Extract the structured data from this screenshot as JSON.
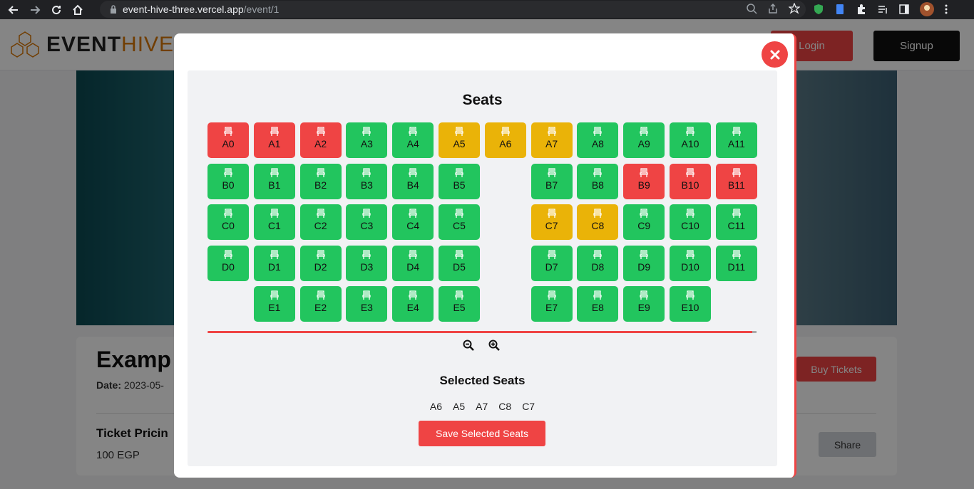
{
  "browser": {
    "url_host": "event-hive-three.vercel.app",
    "url_path": "/event/1"
  },
  "header": {
    "logo_part1": "EVENT",
    "logo_part2": "HIVE",
    "login_label": "Login",
    "signup_label": "Signup"
  },
  "event": {
    "title": "Examp",
    "date_label": "Date:",
    "date_value": "2023-05-",
    "pricing_title": "Ticket Pricin",
    "price": "100 EGP",
    "buy_label": "Buy Tickets",
    "share_label": "Share"
  },
  "modal": {
    "seats_title": "Seats",
    "selected_title": "Selected Seats",
    "selected_seats": [
      "A6",
      "A5",
      "A7",
      "C8",
      "C7"
    ],
    "save_label": "Save Selected Seats"
  },
  "status_colors": {
    "available": "#22c55e",
    "booked": "#ef4444",
    "selected": "#eab308"
  },
  "seat_rows": [
    {
      "row": "A",
      "seats": [
        {
          "label": "A0",
          "status": "booked",
          "col": 0
        },
        {
          "label": "A1",
          "status": "booked",
          "col": 1
        },
        {
          "label": "A2",
          "status": "booked",
          "col": 2
        },
        {
          "label": "A3",
          "status": "available",
          "col": 3
        },
        {
          "label": "A4",
          "status": "available",
          "col": 4
        },
        {
          "label": "A5",
          "status": "selected",
          "col": 5
        },
        {
          "label": "A6",
          "status": "selected",
          "col": 6
        },
        {
          "label": "A7",
          "status": "selected",
          "col": 7
        },
        {
          "label": "A8",
          "status": "available",
          "col": 8
        },
        {
          "label": "A9",
          "status": "available",
          "col": 9
        },
        {
          "label": "A10",
          "status": "available",
          "col": 10
        },
        {
          "label": "A11",
          "status": "available",
          "col": 11
        }
      ]
    },
    {
      "row": "B",
      "seats": [
        {
          "label": "B0",
          "status": "available",
          "col": 0
        },
        {
          "label": "B1",
          "status": "available",
          "col": 1
        },
        {
          "label": "B2",
          "status": "available",
          "col": 2
        },
        {
          "label": "B3",
          "status": "available",
          "col": 3
        },
        {
          "label": "B4",
          "status": "available",
          "col": 4
        },
        {
          "label": "B5",
          "status": "available",
          "col": 5
        },
        {
          "label": "B7",
          "status": "available",
          "col": 7
        },
        {
          "label": "B8",
          "status": "available",
          "col": 8
        },
        {
          "label": "B9",
          "status": "booked",
          "col": 9
        },
        {
          "label": "B10",
          "status": "booked",
          "col": 10
        },
        {
          "label": "B11",
          "status": "booked",
          "col": 11
        }
      ]
    },
    {
      "row": "C",
      "seats": [
        {
          "label": "C0",
          "status": "available",
          "col": 0
        },
        {
          "label": "C1",
          "status": "available",
          "col": 1
        },
        {
          "label": "C2",
          "status": "available",
          "col": 2
        },
        {
          "label": "C3",
          "status": "available",
          "col": 3
        },
        {
          "label": "C4",
          "status": "available",
          "col": 4
        },
        {
          "label": "C5",
          "status": "available",
          "col": 5
        },
        {
          "label": "C7",
          "status": "selected",
          "col": 7
        },
        {
          "label": "C8",
          "status": "selected",
          "col": 8
        },
        {
          "label": "C9",
          "status": "available",
          "col": 9
        },
        {
          "label": "C10",
          "status": "available",
          "col": 10
        },
        {
          "label": "C11",
          "status": "available",
          "col": 11
        }
      ]
    },
    {
      "row": "D",
      "seats": [
        {
          "label": "D0",
          "status": "available",
          "col": 0
        },
        {
          "label": "D1",
          "status": "available",
          "col": 1
        },
        {
          "label": "D2",
          "status": "available",
          "col": 2
        },
        {
          "label": "D3",
          "status": "available",
          "col": 3
        },
        {
          "label": "D4",
          "status": "available",
          "col": 4
        },
        {
          "label": "D5",
          "status": "available",
          "col": 5
        },
        {
          "label": "D7",
          "status": "available",
          "col": 7
        },
        {
          "label": "D8",
          "status": "available",
          "col": 8
        },
        {
          "label": "D9",
          "status": "available",
          "col": 9
        },
        {
          "label": "D10",
          "status": "available",
          "col": 10
        },
        {
          "label": "D11",
          "status": "available",
          "col": 11
        }
      ]
    },
    {
      "row": "E",
      "seats": [
        {
          "label": "E1",
          "status": "available",
          "col": 1
        },
        {
          "label": "E2",
          "status": "available",
          "col": 2
        },
        {
          "label": "E3",
          "status": "available",
          "col": 3
        },
        {
          "label": "E4",
          "status": "available",
          "col": 4
        },
        {
          "label": "E5",
          "status": "available",
          "col": 5
        },
        {
          "label": "E7",
          "status": "available",
          "col": 7
        },
        {
          "label": "E8",
          "status": "available",
          "col": 8
        },
        {
          "label": "E9",
          "status": "available",
          "col": 9
        },
        {
          "label": "E10",
          "status": "available",
          "col": 10
        }
      ]
    }
  ]
}
